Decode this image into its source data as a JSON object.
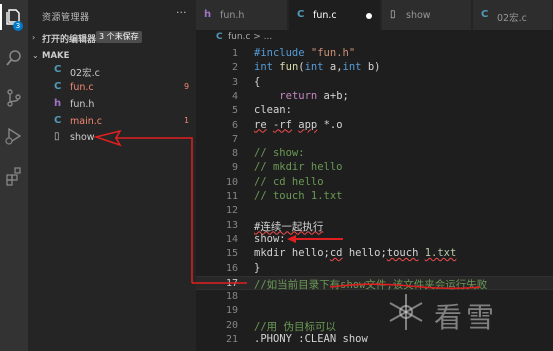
{
  "activity_bar": {
    "icons": [
      "explorer-icon",
      "search-icon",
      "source-control-icon",
      "run-debug-icon",
      "extensions-icon"
    ],
    "explorer_badge": "3"
  },
  "sidebar": {
    "title": "资源管理器",
    "more": "···",
    "open_editors_label": "打开的编辑器",
    "unsaved_badge": "3 个未保存",
    "folder_label": "MAKE",
    "files": [
      {
        "icon": "C",
        "icon_color": "#519aba",
        "name": "02宏.c",
        "name_color": "#cccccc",
        "count": ""
      },
      {
        "icon": "C",
        "icon_color": "#519aba",
        "name": "fun.c",
        "name_color": "#f48771",
        "count": "9"
      },
      {
        "icon": "h",
        "icon_color": "#a074c4",
        "name": "fun.h",
        "name_color": "#cccccc",
        "count": ""
      },
      {
        "icon": "C",
        "icon_color": "#519aba",
        "name": "main.c",
        "name_color": "#f48771",
        "count": "1"
      },
      {
        "icon": "▯",
        "icon_color": "#cccccc",
        "name": "show",
        "name_color": "#cccccc",
        "count": ""
      }
    ]
  },
  "tabs": [
    {
      "icon": "h",
      "icon_color": "#a074c4",
      "label": "fun.h",
      "active": false
    },
    {
      "icon": "C",
      "icon_color": "#519aba",
      "label": "fun.c",
      "active": true
    },
    {
      "icon": "▯",
      "icon_color": "#cccccc",
      "label": "show",
      "active": false
    },
    {
      "icon": "C",
      "icon_color": "#519aba",
      "label": "02宏.c",
      "active": false
    }
  ],
  "breadcrumb": {
    "icon": "C",
    "label": "fun.c > ..."
  },
  "editor": {
    "lines": [
      {
        "n": "1",
        "html": "<span class=\"kw\">#include</span> <span class=\"str\">\"fun.h\"</span>"
      },
      {
        "n": "2",
        "html": "<span class=\"kw\">int</span> <span class=\"fn\">fun</span>(<span class=\"kw\">int</span> a,<span class=\"kw\">int</span> b)"
      },
      {
        "n": "3",
        "html": "{"
      },
      {
        "n": "4",
        "html": "    <span style=\"color:#c586c0\">return</span> a+b;"
      },
      {
        "n": "5",
        "html": "clean:"
      },
      {
        "n": "6",
        "html": "<span class=\"squig\">re</span> <span class=\"squig\">-rf</span> <span class=\"squig\">app</span> *.o"
      },
      {
        "n": "7",
        "html": ""
      },
      {
        "n": "8",
        "html": "<span class=\"cmt\">// show:</span>"
      },
      {
        "n": "9",
        "html": "<span class=\"cmt\">// mkdir hello</span>"
      },
      {
        "n": "10",
        "html": "<span class=\"cmt\">// cd hello</span>"
      },
      {
        "n": "11",
        "html": "<span class=\"cmt\">// touch 1.txt</span>"
      },
      {
        "n": "12",
        "html": ""
      },
      {
        "n": "13",
        "html": "<span class=\"squig\">#连续一起执行</span>"
      },
      {
        "n": "14",
        "html": "show:"
      },
      {
        "n": "15",
        "html": "mkdir hello;<span class=\"squig\">cd</span> hello;<span class=\"squig\">touch</span> <span class=\"squig\" style=\"color:#b5cea8\">1.txt</span>"
      },
      {
        "n": "16",
        "html": "}"
      },
      {
        "n": "17",
        "html": "<span class=\"cmt\">//如当前目录下有show文件,该文件夹会运行失败</span>"
      },
      {
        "n": "18",
        "html": ""
      },
      {
        "n": "19",
        "html": ""
      },
      {
        "n": "20",
        "html": "<span class=\"cmt\">//用 伪目标可以</span>"
      },
      {
        "n": "21",
        "html": ".PHONY :CLEAN show"
      }
    ],
    "current_line": "17"
  },
  "colors": {
    "annotation_red": "#e02020",
    "accent": "#007acc"
  }
}
